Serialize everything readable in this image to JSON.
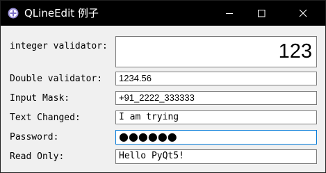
{
  "window": {
    "title": "QLineEdit 例子",
    "titlebar_color": "#000000",
    "focus_color": "#0078d7"
  },
  "icons": {
    "app": "qt-app-icon",
    "minimize": "minimize-icon",
    "maximize": "maximize-icon",
    "close": "close-icon"
  },
  "form": {
    "integer": {
      "label": "integer validator:",
      "value": "123"
    },
    "double": {
      "label": "Double validator:",
      "value": "1234.56"
    },
    "mask": {
      "label": "Input Mask:",
      "value": "+91_2222_333333"
    },
    "changed": {
      "label": "Text Changed:",
      "value": "I am trying"
    },
    "password": {
      "label": "Password:",
      "value": "●●●●●●"
    },
    "readonly": {
      "label": "Read Only:",
      "value": "Hello PyQt5!"
    }
  }
}
